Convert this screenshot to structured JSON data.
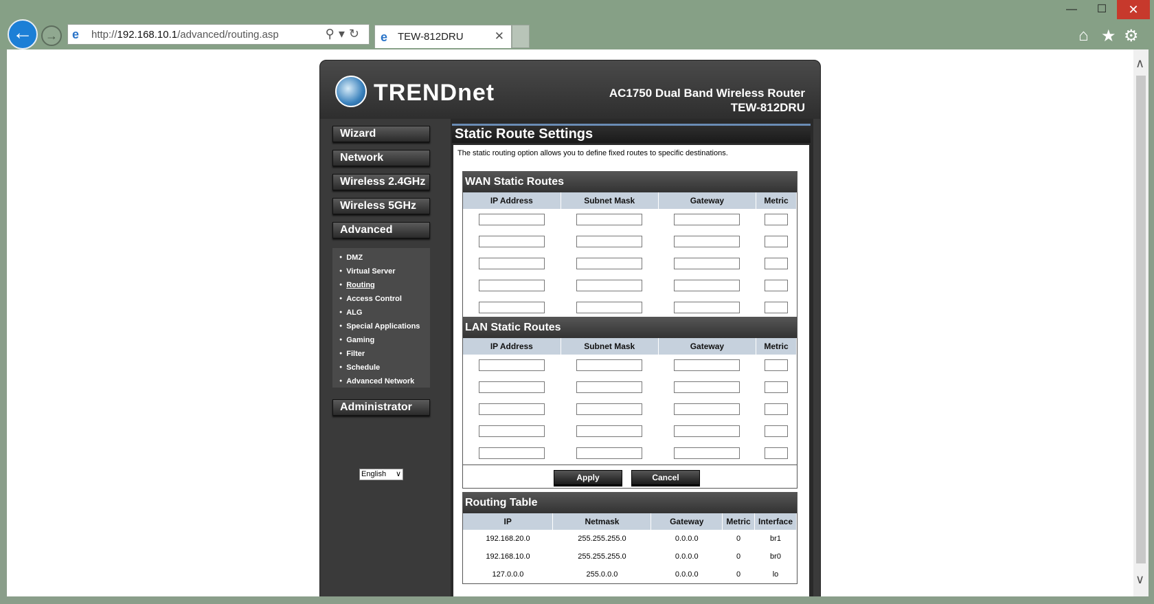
{
  "browser": {
    "url_prefix": "http://",
    "url_host": "192.168.10.1",
    "url_path": "/advanced/routing.asp",
    "tab_title": "TEW-812DRU",
    "icons": [
      "back-arrow-icon",
      "forward-arrow-icon",
      "search-icon",
      "refresh-icon",
      "home-icon",
      "star-icon",
      "gear-icon"
    ]
  },
  "header": {
    "logo": "TRENDnet",
    "model_line1": "AC1750 Dual Band Wireless Router",
    "model_line2": "TEW-812DRU"
  },
  "sidebar": {
    "nav": [
      "Wizard",
      "Network",
      "Wireless 2.4GHz",
      "Wireless 5GHz",
      "Advanced",
      "Administrator"
    ],
    "submenu": [
      "DMZ",
      "Virtual Server",
      "Routing",
      "Access Control",
      "ALG",
      "Special Applications",
      "Gaming",
      "Filter",
      "Schedule",
      "Advanced Network"
    ],
    "active_submenu": "Routing",
    "language": "English"
  },
  "content": {
    "title": "Static Route Settings",
    "description": "The static routing option allows you to define fixed routes to specific destinations.",
    "wan_title": "WAN Static Routes",
    "lan_title": "LAN Static Routes",
    "route_columns": [
      "IP Address",
      "Subnet Mask",
      "Gateway",
      "Metric"
    ],
    "apply_label": "Apply",
    "cancel_label": "Cancel",
    "routing_table_title": "Routing Table",
    "routing_columns": [
      "IP",
      "Netmask",
      "Gateway",
      "Metric",
      "Interface"
    ],
    "routing_rows": [
      [
        "192.168.20.0",
        "255.255.255.0",
        "0.0.0.0",
        "0",
        "br1"
      ],
      [
        "192.168.10.0",
        "255.255.255.0",
        "0.0.0.0",
        "0",
        "br0"
      ],
      [
        "127.0.0.0",
        "255.0.0.0",
        "0.0.0.0",
        "0",
        "lo"
      ]
    ]
  }
}
